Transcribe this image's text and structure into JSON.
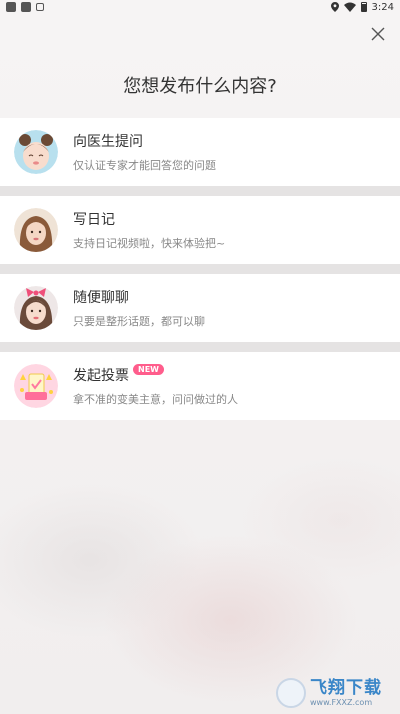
{
  "status_bar": {
    "time": "3:24",
    "icons": [
      "app-icon",
      "app-icon",
      "notification-icon",
      "location-icon",
      "wifi-icon",
      "battery-icon"
    ]
  },
  "header": {
    "title": "您想发布什么内容?"
  },
  "menu": {
    "items": [
      {
        "title": "向医生提问",
        "subtitle": "仅认证专家才能回答您的问题",
        "badge": ""
      },
      {
        "title": "写日记",
        "subtitle": "支持日记视频啦，快来体验把~",
        "badge": ""
      },
      {
        "title": "随便聊聊",
        "subtitle": "只要是整形话题，都可以聊",
        "badge": ""
      },
      {
        "title": "发起投票",
        "subtitle": "拿不准的变美主意，问问做过的人",
        "badge": "NEW"
      }
    ]
  },
  "watermark": {
    "name": "飞翔下载",
    "url": "www.FXXZ.com"
  },
  "colors": {
    "badge": "#ff5d8c",
    "divider": "#e5e3e3",
    "watermark_blue": "#3a86c8"
  }
}
